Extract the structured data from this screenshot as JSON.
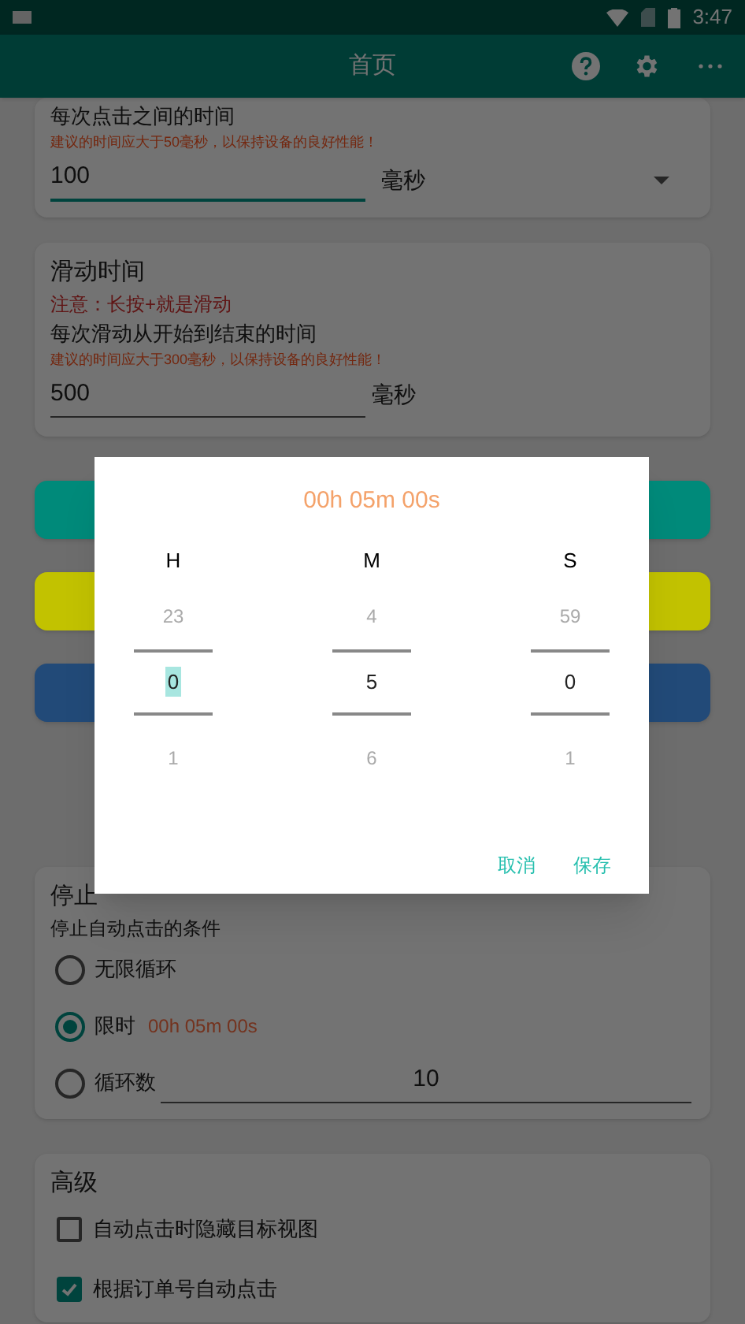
{
  "status_bar": {
    "time": "3:47"
  },
  "app_bar": {
    "title": "首页"
  },
  "click_interval": {
    "description": "每次点击之间的时间",
    "hint": "建议的时间应大于50毫秒，以保持设备的良好性能！",
    "value": "100",
    "unit": "毫秒"
  },
  "swipe_time": {
    "title": "滑动时间",
    "warning": "注意：长按+就是滑动",
    "description": "每次滑动从开始到结束的时间",
    "hint": "建议的时间应大于300毫秒，以保持设备的良好性能！",
    "value": "500",
    "unit": "毫秒"
  },
  "action_buttons": [
    {
      "color": "#008a7a"
    },
    {
      "color": "#c2c200"
    },
    {
      "color": "#224a78"
    }
  ],
  "stop": {
    "title": "停止",
    "subtitle": "停止自动点击的条件",
    "options": [
      {
        "kind": "plain",
        "label": "无限循环",
        "selected": false
      },
      {
        "kind": "timer",
        "label": "限时",
        "selected": true,
        "detail": "00h 05m 00s"
      },
      {
        "kind": "count",
        "label": "循环数",
        "selected": false,
        "value": "10"
      }
    ]
  },
  "advanced": {
    "title": "高级",
    "options": [
      {
        "label": "自动点击时隐藏目标视图",
        "checked": false
      },
      {
        "label": "根据订单号自动点击",
        "checked": true
      }
    ]
  },
  "dialog": {
    "title": "00h 05m 00s",
    "columns": [
      {
        "label": "H",
        "prev": "23",
        "value": "0",
        "next": "1",
        "focused": true
      },
      {
        "label": "M",
        "prev": "4",
        "value": "5",
        "next": "6",
        "focused": false
      },
      {
        "label": "S",
        "prev": "59",
        "value": "0",
        "next": "1",
        "focused": false
      }
    ],
    "buttons": [
      "取消",
      "保存"
    ]
  }
}
